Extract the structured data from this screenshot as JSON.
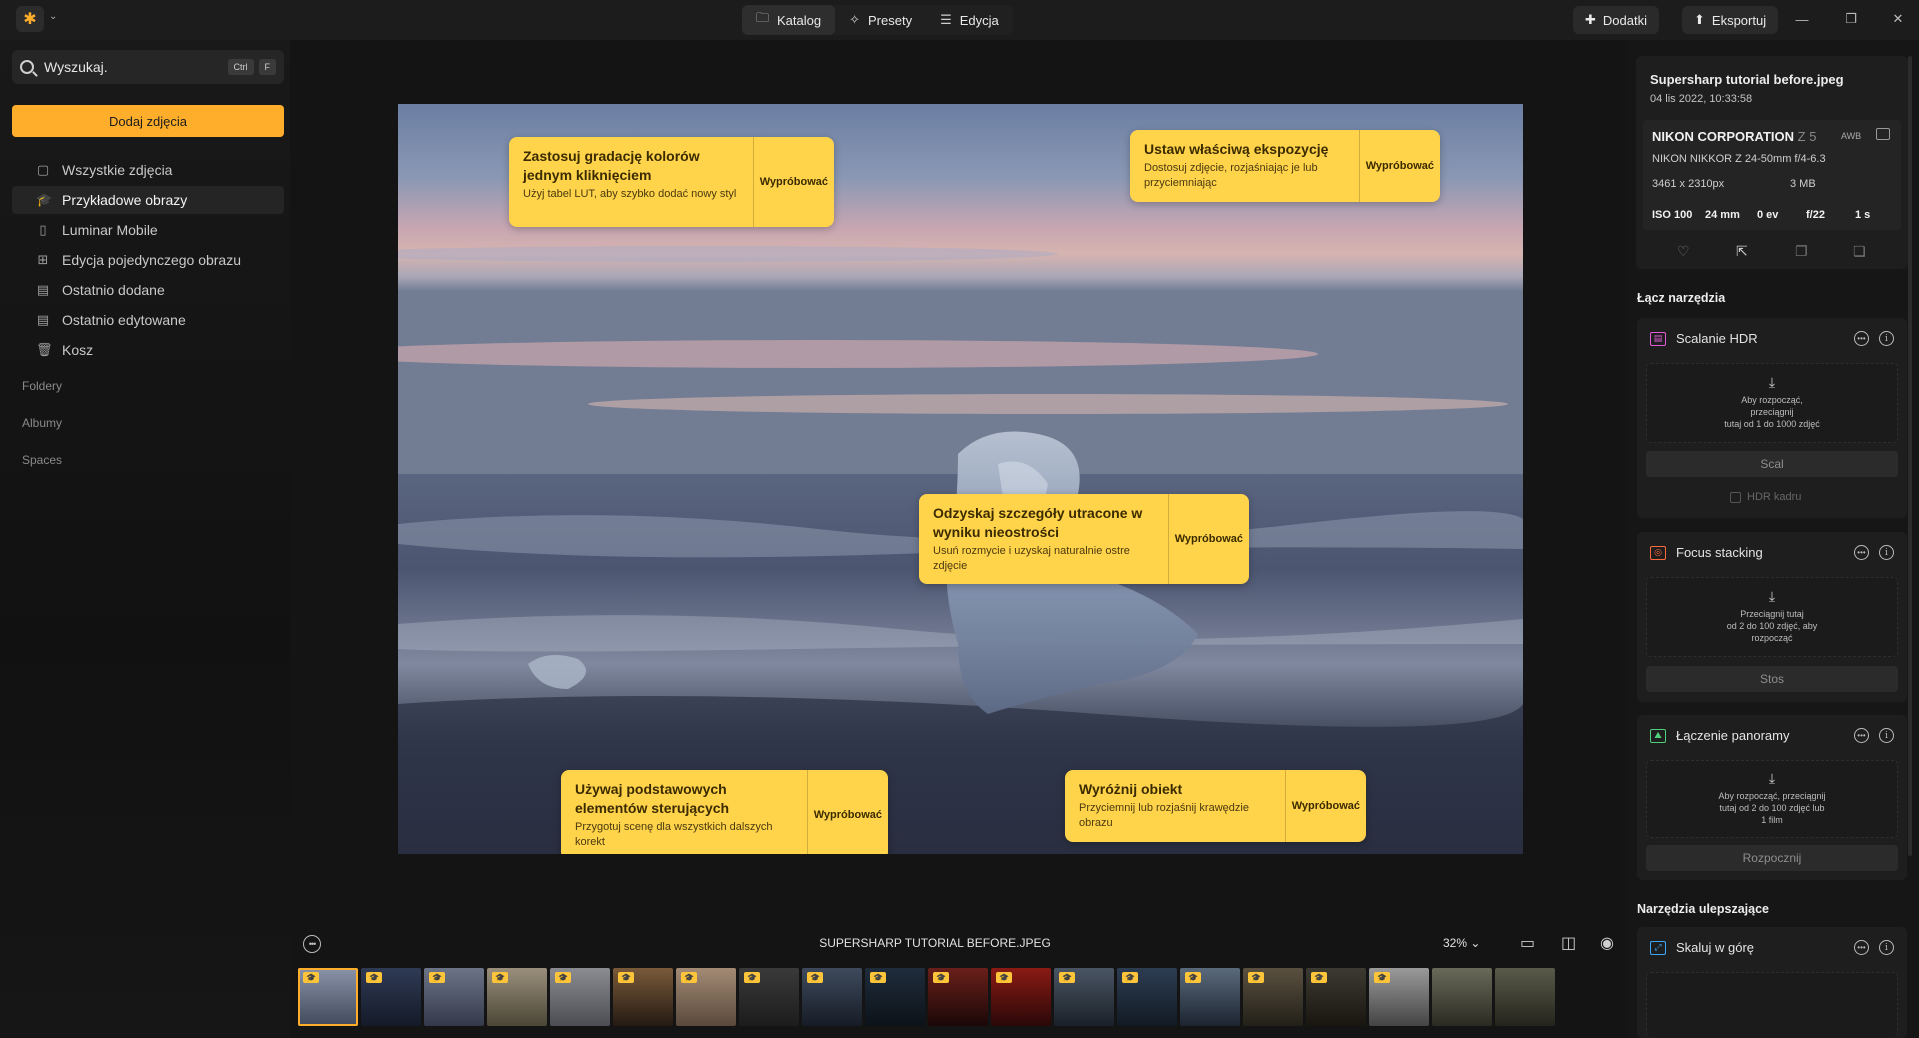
{
  "topbar": {
    "tabs": [
      {
        "label": "Katalog",
        "icon": "folder-icon",
        "active": true
      },
      {
        "label": "Presety",
        "icon": "sparkle-icon",
        "active": false
      },
      {
        "label": "Edycja",
        "icon": "sliders-icon",
        "active": false
      }
    ],
    "addons_label": "Dodatki",
    "export_label": "Eksportuj"
  },
  "sidebar": {
    "search_placeholder": "Wyszukaj.",
    "shortcut_ctrl": "Ctrl",
    "shortcut_key": "F",
    "add_button": "Dodaj zdjęcia",
    "items": [
      {
        "label": "Wszystkie zdjęcia",
        "icon": "photos-icon"
      },
      {
        "label": "Przykładowe obrazy",
        "icon": "graduation-cap-icon",
        "active": true
      },
      {
        "label": "Luminar Mobile",
        "icon": "phone-icon"
      },
      {
        "label": "Edycja pojedynczego obrazu",
        "icon": "grid-icon"
      },
      {
        "label": "Ostatnio dodane",
        "icon": "calendar-add-icon"
      },
      {
        "label": "Ostatnio edytowane",
        "icon": "calendar-edit-icon"
      },
      {
        "label": "Kosz",
        "icon": "trash-icon"
      }
    ],
    "sections": {
      "folders": "Foldery",
      "albums": "Albumy",
      "spaces": "Spaces"
    }
  },
  "tips": [
    {
      "title": "Zastosuj gradację kolorów jednym kliknięciem",
      "desc": "Użyj tabel LUT, aby szybko dodać nowy styl",
      "try": "Wypróbować"
    },
    {
      "title": "Ustaw właściwą ekspozycję",
      "desc": "Dostosuj zdjęcie, rozjaśniając je lub przyciemniając",
      "try": "Wypróbować"
    },
    {
      "title": "Odzyskaj szczegóły utracone w wyniku nieostrości",
      "desc": "Usuń rozmycie i uzyskaj naturalnie ostre zdjęcie",
      "try": "Wypróbować"
    },
    {
      "title": "Używaj podstawowych elementów sterujących",
      "desc": "Przygotuj scenę dla wszystkich dalszych korekt",
      "try": "Wypróbować"
    },
    {
      "title": "Wyróżnij obiekt",
      "desc": "Przyciemnij lub rozjaśnij krawędzie obrazu",
      "try": "Wypróbować"
    }
  ],
  "filmstrip": {
    "filename": "SUPERSHARP TUTORIAL BEFORE.JPEG",
    "zoom": "32%",
    "thumb_count": 20,
    "badged_count": 18
  },
  "info": {
    "filename": "Supersharp tutorial before.jpeg",
    "datetime": "04 lis 2022, 10:33:58",
    "camera_maker": "NIKON CORPORATION",
    "camera_model": "Z 5",
    "wb": "AWB",
    "lens": "NIKON NIKKOR Z 24-50mm f/4-6.3",
    "dimensions": "3461 x 2310px",
    "filesize": "3 MB",
    "iso": "ISO 100",
    "focal": "24 mm",
    "ev": "0 ev",
    "aperture": "f/22",
    "shutter": "1 s"
  },
  "right": {
    "combine_title": "Łącz narzędzia",
    "enhance_title": "Narzędzia ulepszające",
    "tools": [
      {
        "name": "Scalanie HDR",
        "icon": "hdr-icon",
        "color": "#e05ad8",
        "drop": "Aby rozpocząć,\nprzeciągnij\ntutaj od 1 do 1000 zdjęć",
        "button": "Scal",
        "checkbox": "HDR kadru"
      },
      {
        "name": "Focus stacking",
        "icon": "focus-stack-icon",
        "color": "#ff6a3d",
        "drop": "Przeciągnij tutaj\nod 2 do 100 zdjęć, aby\nrozpocząć",
        "button": "Stos"
      },
      {
        "name": "Łączenie panoramy",
        "icon": "panorama-icon",
        "color": "#4fd07a",
        "drop": "Aby rozpocząć, przeciągnij\ntutaj od 2 do 100 zdjęć lub\n1 film",
        "button": "Rozpocznij"
      },
      {
        "name": "Skaluj w górę",
        "icon": "upscale-icon",
        "color": "#3aa8ff"
      }
    ]
  },
  "colors": {
    "accent": "#ffae2b",
    "tip_bg": "#ffd34a",
    "bg": "#141414"
  }
}
